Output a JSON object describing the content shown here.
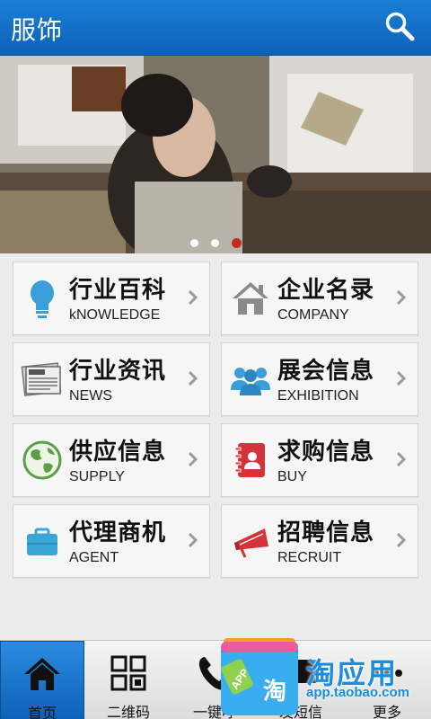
{
  "header": {
    "title": "服饰",
    "search_icon": "search-icon"
  },
  "banner": {
    "dots": [
      "inactive",
      "inactive",
      "active"
    ],
    "accent": "#c32a1f"
  },
  "categories": [
    {
      "cn": "行业百科",
      "en": "kNOWLEDGE",
      "icon": "lightbulb-icon"
    },
    {
      "cn": "企业名录",
      "en": "COMPANY",
      "icon": "house-icon"
    },
    {
      "cn": "行业资讯",
      "en": "NEWS",
      "icon": "newspaper-icon"
    },
    {
      "cn": "展会信息",
      "en": "EXHIBITION",
      "icon": "people-icon"
    },
    {
      "cn": "供应信息",
      "en": "SUPPLY",
      "icon": "globe-icon"
    },
    {
      "cn": "求购信息",
      "en": "BUY",
      "icon": "address-book-icon"
    },
    {
      "cn": "代理商机",
      "en": "AGENT",
      "icon": "briefcase-icon"
    },
    {
      "cn": "招聘信息",
      "en": "RECRUIT",
      "icon": "megaphone-icon"
    }
  ],
  "tabbar": {
    "tabs": [
      {
        "label": "首页",
        "icon": "home-icon",
        "active": true
      },
      {
        "label": "二维码",
        "icon": "qr-grid-icon",
        "active": false
      },
      {
        "label": "一键呼",
        "icon": "phone-icon",
        "active": false
      },
      {
        "label": "发短信",
        "icon": "message-icon",
        "active": false
      },
      {
        "label": "更多",
        "icon": "more-icon",
        "active": false
      }
    ]
  },
  "watermark": {
    "name": "淘应用",
    "url": "app.taobao.com",
    "badge_text": "APP",
    "badge_cn": "淘"
  },
  "colors": {
    "primary": "#0d62b8",
    "icon_blue": "#3a9fd8",
    "icon_red": "#d2343a",
    "icon_green": "#5aa048"
  }
}
